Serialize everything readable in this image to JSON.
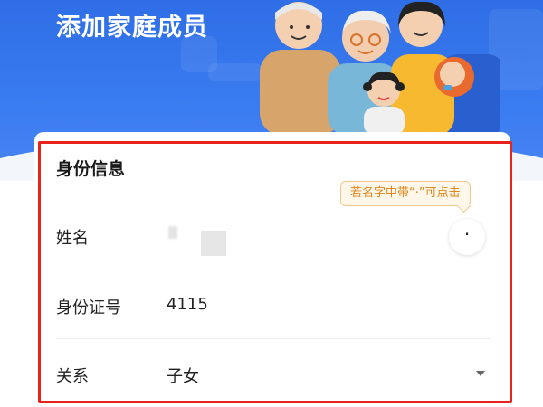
{
  "header": {
    "title": "添加家庭成员"
  },
  "form": {
    "section_title": "身份信息",
    "tooltip": "若名字中带“·”可点击",
    "dot_button": "·",
    "fields": {
      "name": {
        "label": "姓名",
        "value": ""
      },
      "id_number": {
        "label": "身份证号",
        "value": "4115"
      },
      "relation": {
        "label": "关系",
        "value": "子女"
      }
    }
  },
  "colors": {
    "header_blue": "#2f6ee6",
    "highlight_red": "#e8231b",
    "tooltip_orange": "#e0861a"
  }
}
